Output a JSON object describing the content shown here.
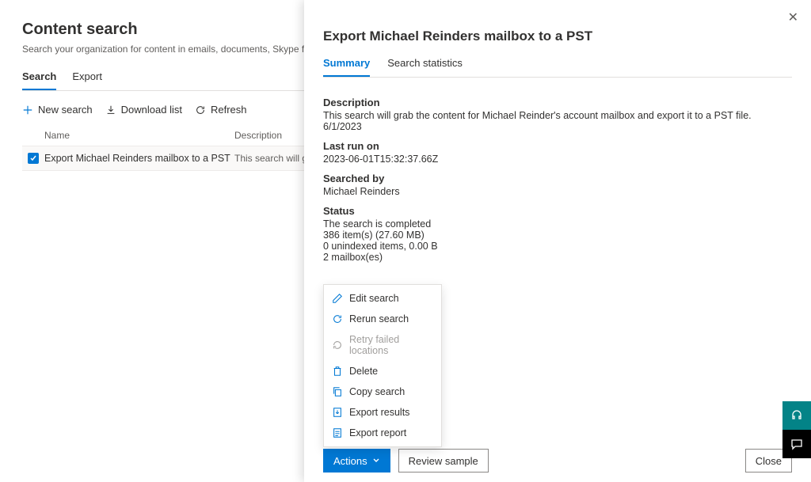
{
  "main": {
    "title": "Content search",
    "subtitle": "Search your organization for content in emails, documents, Skype for Business conversat",
    "tabs": [
      {
        "label": "Search",
        "active": true
      },
      {
        "label": "Export",
        "active": false
      }
    ],
    "toolbar": {
      "new_search": "New search",
      "download_list": "Download list",
      "refresh": "Refresh"
    },
    "table": {
      "columns": {
        "name": "Name",
        "description": "Description"
      },
      "rows": [
        {
          "checked": true,
          "name": "Export Michael Reinders mailbox to a PST",
          "description": "This search will grab the"
        }
      ]
    }
  },
  "panel": {
    "title": "Export Michael Reinders mailbox to a PST",
    "tabs": [
      {
        "label": "Summary",
        "active": true
      },
      {
        "label": "Search statistics",
        "active": false
      }
    ],
    "fields": {
      "description_label": "Description",
      "description_value": "This search will grab the content for Michael Reinder's account mailbox and export it to a PST file. 6/1/2023",
      "lastrun_label": "Last run on",
      "lastrun_value": "2023-06-01T15:32:37.66Z",
      "searchedby_label": "Searched by",
      "searchedby_value": "Michael Reinders",
      "status_label": "Status",
      "status_lines": {
        "l1": "The search is completed",
        "l2": "386 item(s) (27.60 MB)",
        "l3": "0 unindexed items, 0.00 B",
        "l4": "2 mailbox(es)"
      }
    },
    "menu": {
      "edit": "Edit search",
      "rerun": "Rerun search",
      "retry": "Retry failed locations",
      "delete": "Delete",
      "copy": "Copy search",
      "export_results": "Export results",
      "export_report": "Export report"
    },
    "footer": {
      "actions": "Actions",
      "review": "Review sample",
      "close": "Close"
    }
  }
}
